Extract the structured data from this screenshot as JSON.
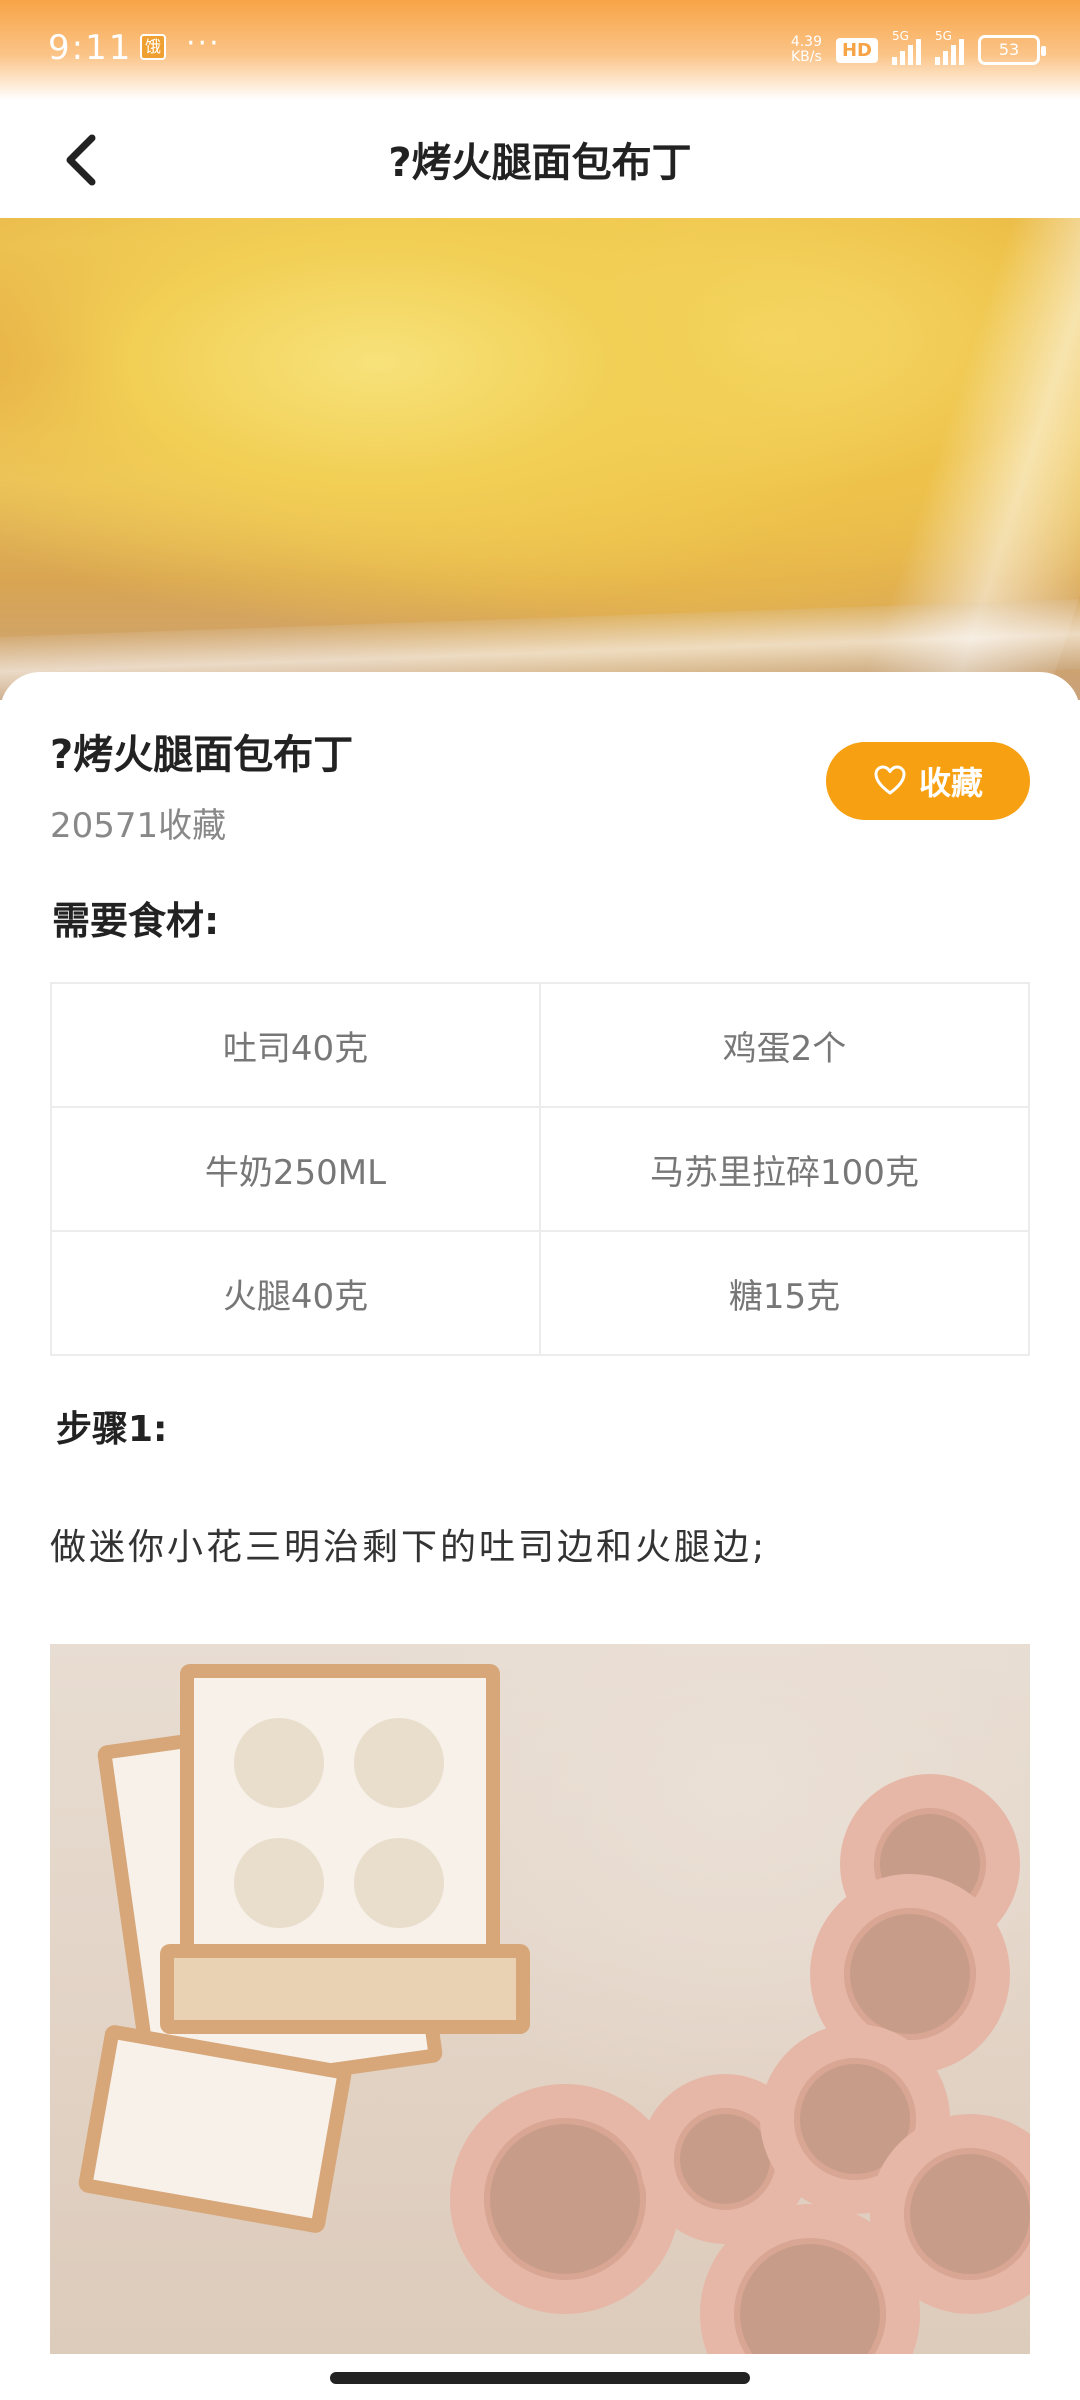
{
  "status_bar": {
    "time": "9:11",
    "app_icon": "饿",
    "more": "···",
    "net_speed_value": "4.39",
    "net_speed_unit": "KB/s",
    "hd_label": "HD",
    "signal_1_label": "5G",
    "signal_2_label": "5G",
    "battery_level": "53"
  },
  "header": {
    "back_icon": "chevron-left-icon",
    "title": "?烤火腿面包布丁"
  },
  "recipe": {
    "title": "?烤火腿面包布丁",
    "favorite_count": "20571收藏",
    "favorite_button_label": "收藏",
    "favorite_icon": "heart-outline-icon",
    "ingredients_label": "需要食材:",
    "ingredients": [
      "吐司40克",
      "鸡蛋2个",
      "牛奶250ML",
      "马苏里拉碎100克",
      "火腿40克",
      "糖15克"
    ],
    "steps": [
      {
        "label": "步骤1:",
        "text": "做迷你小花三明治剩下的吐司边和火腿边;"
      }
    ]
  },
  "colors": {
    "accent": "#f7a012",
    "status_bar": "#f7a446"
  }
}
